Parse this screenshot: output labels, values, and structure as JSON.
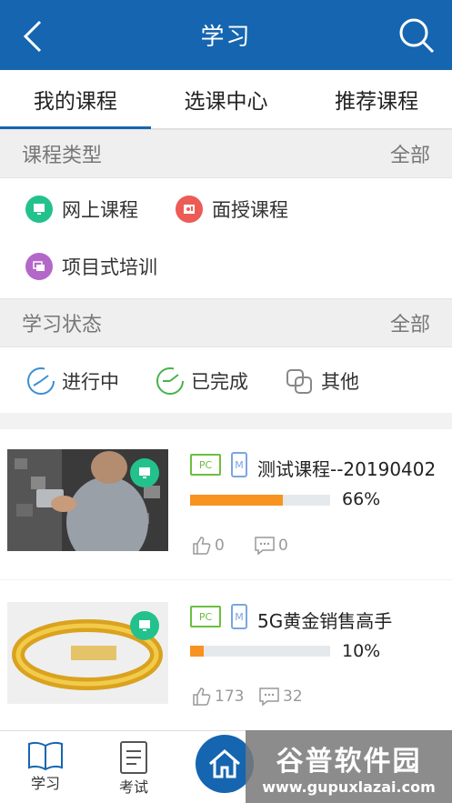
{
  "header": {
    "title": "学习"
  },
  "tabs": [
    {
      "label": "我的课程",
      "active": true
    },
    {
      "label": "选课中心",
      "active": false
    },
    {
      "label": "推荐课程",
      "active": false
    }
  ],
  "course_type": {
    "label": "课程类型",
    "all_label": "全部",
    "options": [
      {
        "label": "网上课程",
        "icon": "monitor-icon",
        "color": "#23c28c"
      },
      {
        "label": "面授课程",
        "icon": "classroom-icon",
        "color": "#ec5b56"
      },
      {
        "label": "项目式培训",
        "icon": "project-icon",
        "color": "#b368c9"
      }
    ]
  },
  "study_status": {
    "label": "学习状态",
    "all_label": "全部",
    "options": [
      {
        "label": "进行中",
        "icon": "in-progress-icon"
      },
      {
        "label": "已完成",
        "icon": "completed-icon"
      },
      {
        "label": "其他",
        "icon": "other-icon"
      }
    ]
  },
  "courses": [
    {
      "title": "测试课程--20190402",
      "tags": [
        "PC",
        "M"
      ],
      "progress": 0.66,
      "progress_label": "66%",
      "likes": "0",
      "comments": "0"
    },
    {
      "title": "5G黄金销售高手",
      "tags": [
        "PC",
        "M"
      ],
      "progress": 0.1,
      "progress_label": "10%",
      "likes": "173",
      "comments": "32"
    }
  ],
  "bottom_nav": [
    {
      "label": "学习"
    },
    {
      "label": "考试"
    }
  ],
  "watermark": {
    "line1": "谷普软件园",
    "line2": "www.gupuxlazai.com"
  },
  "colors": {
    "primary": "#1565b0",
    "progress": "#f7931e",
    "online": "#23c28c",
    "offline": "#ec5b56",
    "project": "#b368c9"
  }
}
